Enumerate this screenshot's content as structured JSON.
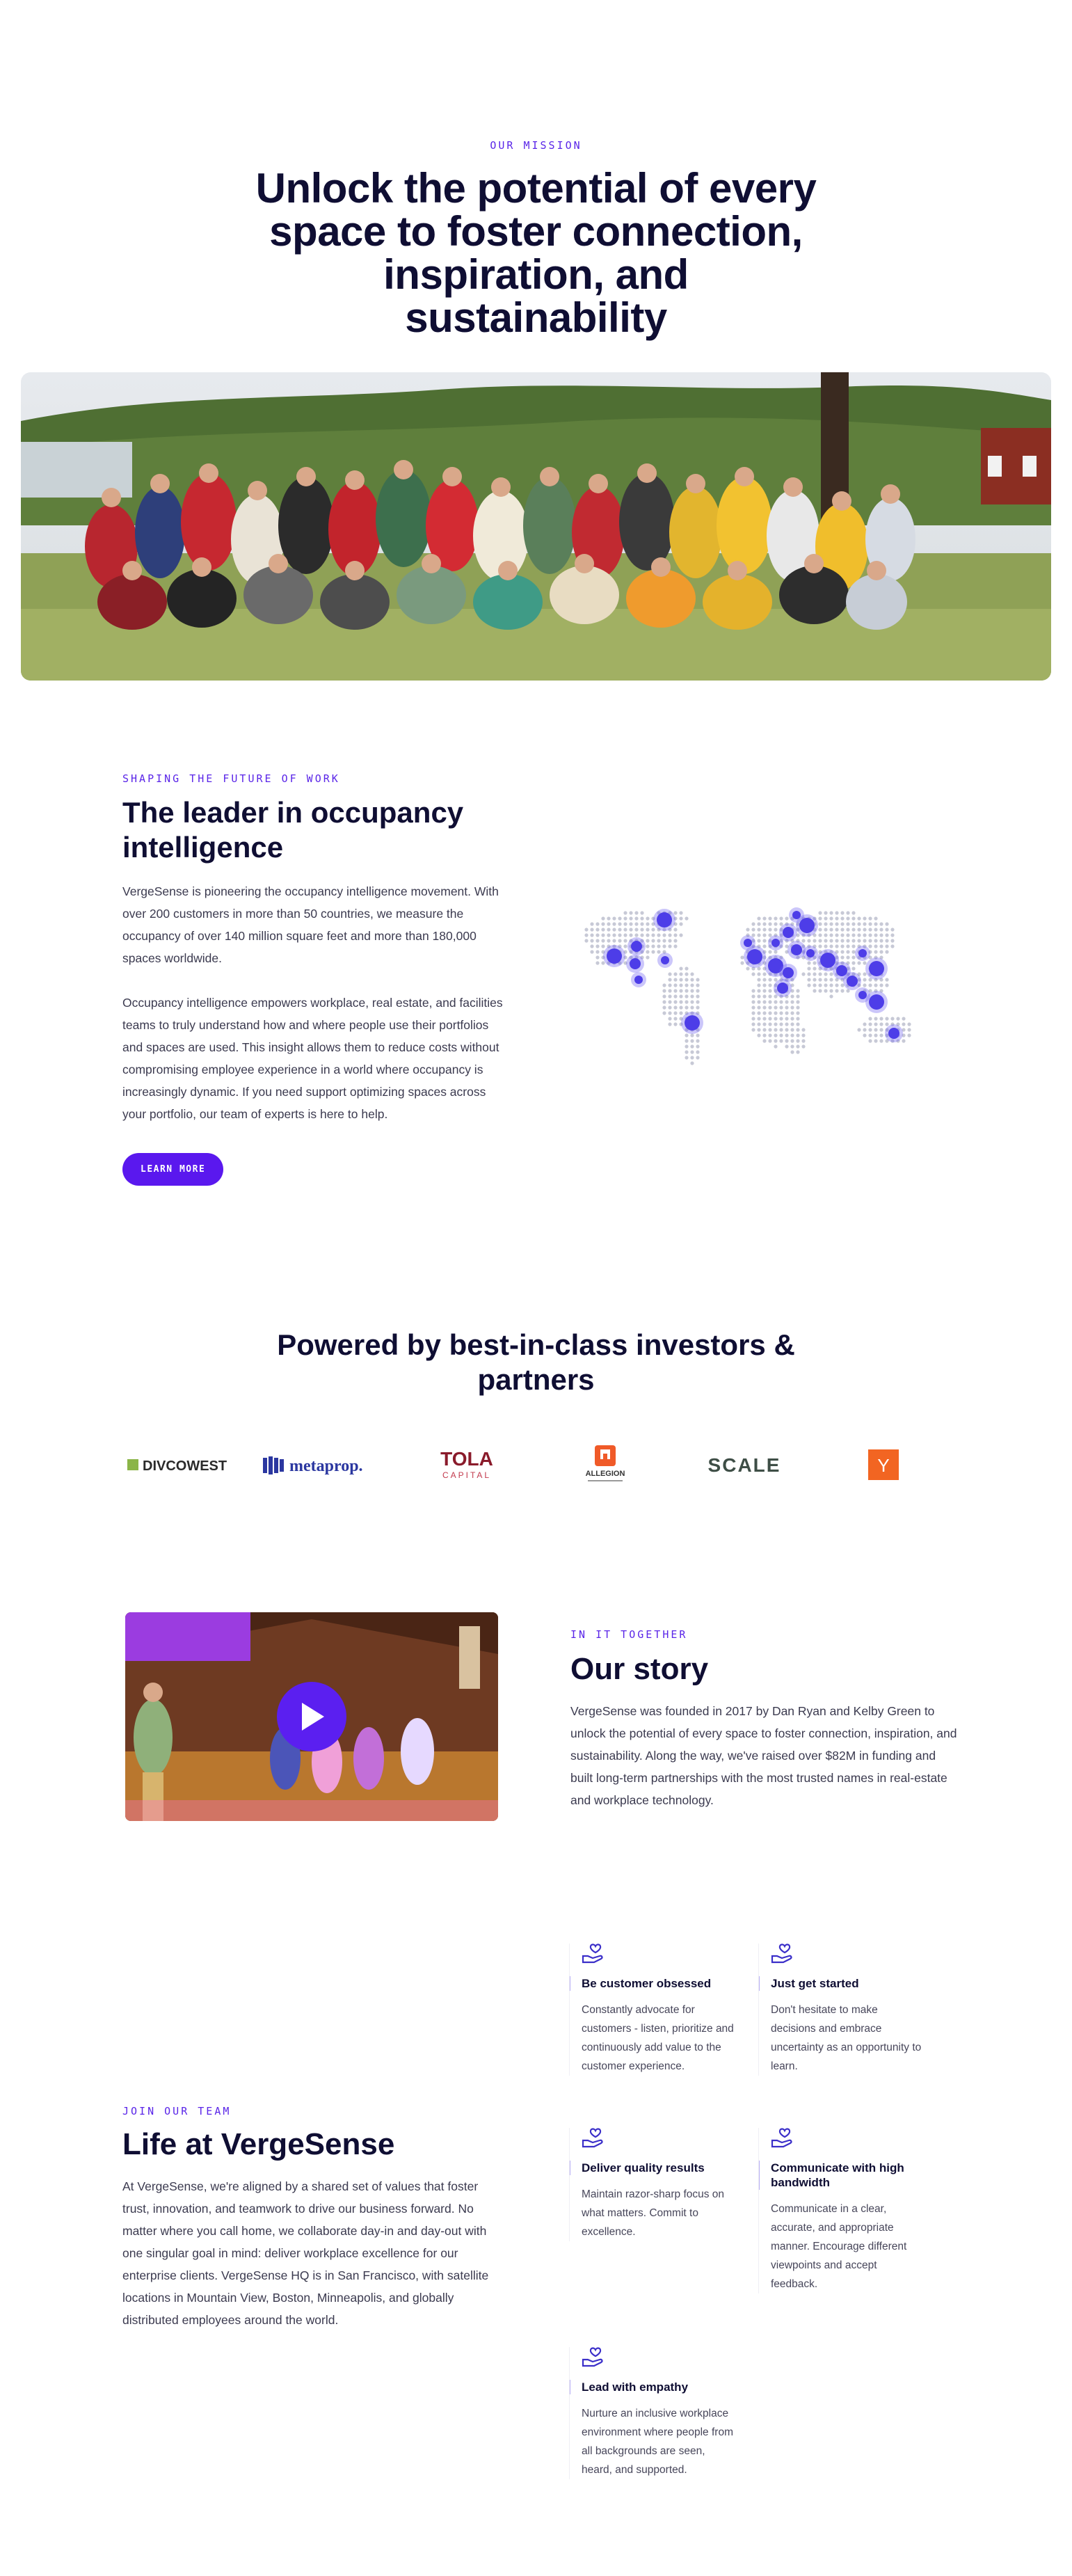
{
  "mission": {
    "eyebrow": "OUR MISSION",
    "title": "Unlock the potential of every space to foster connection, inspiration, and sustainability"
  },
  "hero_photo": {
    "icon": "group-photo-image"
  },
  "leader": {
    "eyebrow": "SHAPING THE FUTURE OF WORK",
    "title": "The leader in occupancy intelligence",
    "paragraph1": "VergeSense is pioneering the occupancy intelligence movement. With over 200 customers in more than 50 countries, we measure the occupancy of over 140 million square feet and more than 180,000 spaces worldwide.",
    "paragraph2": "Occupancy intelligence empowers workplace, real estate, and facilities teams to truly understand how and where people use their portfolios and spaces are used. This insight allows them to reduce costs without compromising employee experience in a world where occupancy is increasingly dynamic. If you need support optimizing spaces across your portfolio, our team of experts is here to help.",
    "cta": "LEARN MORE"
  },
  "investors": {
    "title": "Powered by best-in-class investors & partners",
    "logos": {
      "divco": "DIVCOWEST",
      "metaprop": "metaprop.",
      "tola_main": "TOLA",
      "tola_sub": "CAPITAL",
      "allegion": "ALLEGION",
      "scale": "SCALE",
      "yc": "Y"
    }
  },
  "story": {
    "eyebrow": "IN IT TOGETHER",
    "title": "Our story",
    "paragraph": "VergeSense was founded in 2017 by Dan Ryan and Kelby Green to unlock the potential of every space to foster connection, inspiration, and sustainability. Along the way, we've raised over $82M in funding and built long-term partnerships with the most trusted names in real-estate and workplace technology."
  },
  "life": {
    "eyebrow": "JOIN OUR TEAM",
    "title": "Life at VergeSense",
    "paragraph": "At VergeSense, we're aligned by a shared set of values that foster trust, innovation, and teamwork to drive our business forward. No matter where you call home, we collaborate day-in and day-out with one singular goal in mind: deliver workplace excellence for our enterprise clients. VergeSense HQ is in San Francisco, with satellite locations in Mountain View, Boston, Minneapolis, and globally distributed employees around the world."
  },
  "values": [
    {
      "title": "Be customer obsessed",
      "text": "Constantly advocate for customers - listen, prioritize and continuously add value to the customer experience."
    },
    {
      "title": "Just get started",
      "text": "Don't hesitate to make decisions and embrace uncertainty as an opportunity to learn."
    },
    {
      "title": "Deliver quality results",
      "text": "Maintain razor-sharp focus on what matters. Commit to excellence."
    },
    {
      "title": "Communicate with high bandwidth",
      "text": "Communicate in a clear, accurate, and appropriate manner. Encourage different viewpoints and accept feedback."
    },
    {
      "title": "Lead with empathy",
      "text": "Nurture an inclusive workplace environment where people from all backgrounds are seen, heard, and supported."
    }
  ],
  "colors": {
    "accent": "#5a18ee",
    "heading": "#0f0e33",
    "body": "#3b3a4f"
  }
}
